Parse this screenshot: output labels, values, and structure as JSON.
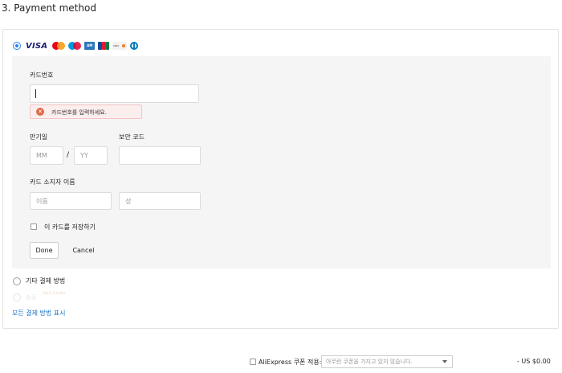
{
  "section": {
    "title": "3. Payment method"
  },
  "card_brands": {
    "visa": "VISA",
    "icons": [
      "visa-icon",
      "mastercard-icon",
      "maestro-icon",
      "amex-icon",
      "jcb-icon",
      "discover-icon",
      "diners-club-icon"
    ]
  },
  "card_form": {
    "card_number_label": "카드번호",
    "card_number_value": "",
    "error_message": "카드번호를 입력하세요.",
    "expiry_label": "만기일",
    "month_placeholder": "MM",
    "expiry_separator": "/",
    "year_placeholder": "YY",
    "security_code_label": "보안 코드",
    "security_code_placeholder": "",
    "holder_label": "카드 소지자 이름",
    "first_name_placeholder": "이름",
    "last_name_placeholder": "성",
    "save_card_label": "이 카드를 저장하기",
    "save_card_checked": false,
    "done_label": "Done",
    "cancel_label": "Cancel"
  },
  "other_methods": {
    "label": "기타 결제 방법",
    "remittance_label": "송금",
    "bank_transfer_label": "Bank Transfer"
  },
  "show_all_link": "모든 결제 방법 표시",
  "coupon": {
    "checkbox_label": "AliExpress 쿠폰 적용:",
    "select_value": "아무런 쿠폰을 가지고 있지 않습니다.",
    "amount": "- US $0.00"
  },
  "colors": {
    "accent": "#2f80ed",
    "link": "#1a73c8",
    "error_bg": "#fdeeee",
    "error_icon": "#e06a4a",
    "form_bg": "#f5f5f5"
  }
}
